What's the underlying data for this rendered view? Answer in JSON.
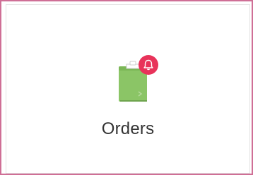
{
  "tile": {
    "label": "Orders",
    "icon": "clipboard-icon",
    "badge_icon": "bell-icon"
  },
  "colors": {
    "frame_border": "#cf6f96",
    "clipboard_green": "#8bc566",
    "badge_red": "#e8335a"
  }
}
